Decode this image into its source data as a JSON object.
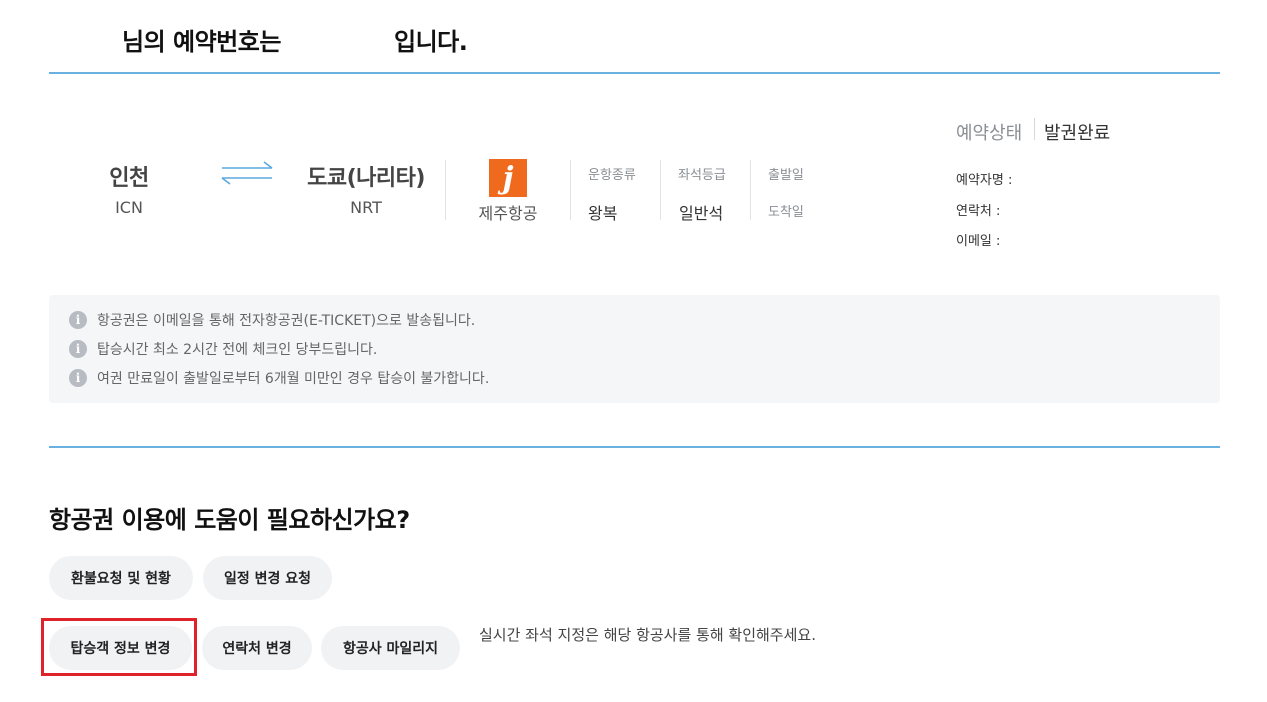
{
  "header": {
    "title_part1": "님의 예약번호는",
    "title_part2": "입니다."
  },
  "itinerary": {
    "origin_city": "인천",
    "origin_code": "ICN",
    "dest_city": "도쿄(나리타)",
    "dest_code": "NRT",
    "airline_logo_letter": "j",
    "airline_name": "제주항공",
    "trip_type_label": "운항종류",
    "trip_type_value": "왕복",
    "seat_class_label": "좌석등급",
    "seat_class_value": "일반석",
    "departure_label": "출발일",
    "arrival_label": "도착일"
  },
  "reservation": {
    "status_label": "예약상태",
    "status_value": "발권완료",
    "booker_label": "예약자명 :",
    "contact_label": "연락처 :",
    "email_label": "이메일 :"
  },
  "notices": [
    "항공권은 이메일을 통해 전자항공권(E-TICKET)으로 발송됩니다.",
    "탑승시간 최소 2시간 전에 체크인 당부드립니다.",
    "여권 만료일이 출발일로부터 6개월 미만인 경우 탑승이 불가합니다."
  ],
  "help": {
    "title": "항공권 이용에 도움이 필요하신가요?",
    "buttons": [
      "환불요청 및 현황",
      "일정 변경 요청",
      "탑승객 정보 변경",
      "연락처 변경",
      "항공사 마일리지"
    ],
    "seat_note": "실시간 좌석 지정은 해당 항공사를 통해 확인해주세요."
  },
  "colors": {
    "divider": "#6ab0e0",
    "airline_brand": "#f06a1d",
    "highlight": "#e0222b"
  },
  "icons": {
    "route": "double-arrow-icon",
    "notice": "info-icon"
  }
}
